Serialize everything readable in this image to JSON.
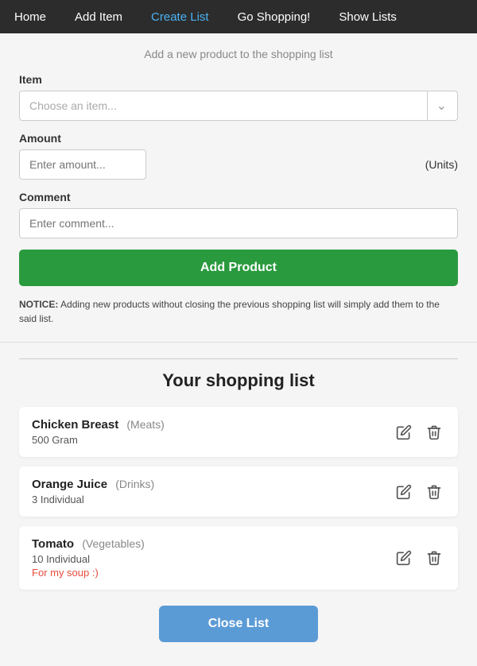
{
  "nav": {
    "items": [
      {
        "label": "Home",
        "active": false
      },
      {
        "label": "Add Item",
        "active": false
      },
      {
        "label": "Create List",
        "active": true
      },
      {
        "label": "Go Shopping!",
        "active": false
      },
      {
        "label": "Show Lists",
        "active": false
      }
    ]
  },
  "form": {
    "subtitle": "Add a new product to the shopping list",
    "item_label": "Item",
    "item_placeholder": "Choose an item...",
    "amount_label": "Amount",
    "amount_placeholder": "Enter amount...",
    "units_label": "(Units)",
    "comment_label": "Comment",
    "comment_placeholder": "Enter comment...",
    "add_button_label": "Add Product",
    "notice": "NOTICE:",
    "notice_text": " Adding new products without closing the previous shopping list will simply add them to the said list."
  },
  "shopping_list": {
    "title": "Your shopping list",
    "items": [
      {
        "name": "Chicken Breast",
        "category": "(Meats)",
        "amount": "500 Gram",
        "comment": ""
      },
      {
        "name": "Orange Juice",
        "category": "(Drinks)",
        "amount": "3 Individual",
        "comment": ""
      },
      {
        "name": "Tomato",
        "category": "(Vegetables)",
        "amount": "10 Individual",
        "comment": "For my soup :)"
      }
    ],
    "close_button_label": "Close List"
  }
}
